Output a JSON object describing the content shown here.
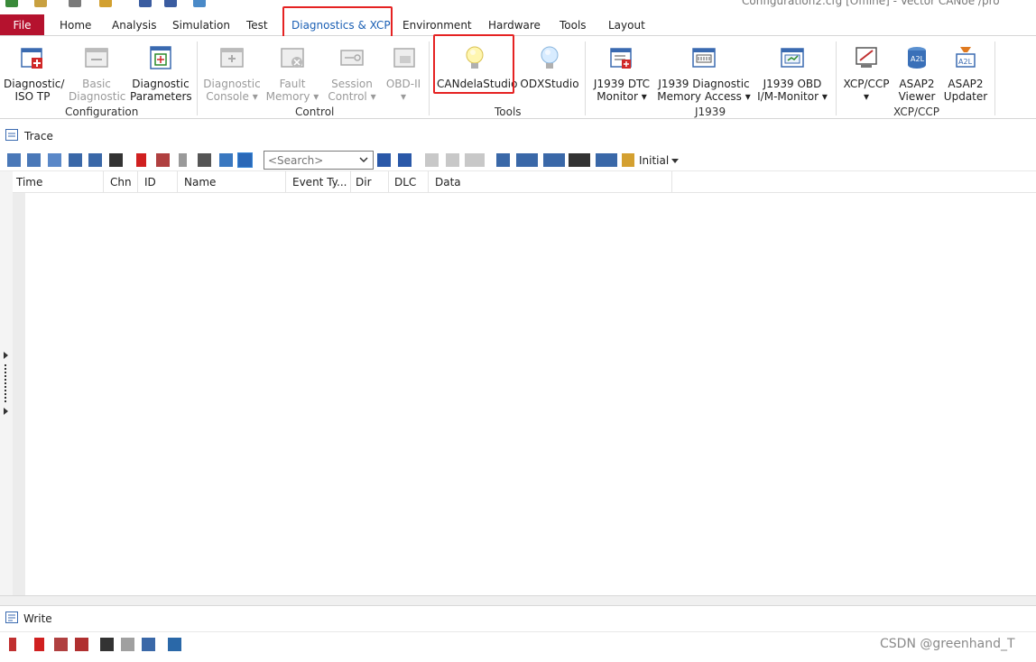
{
  "window": {
    "title": "Configuration2.cfg [Offline] - Vector CANoe /pro"
  },
  "ribbon_tabs": [
    "File",
    "Home",
    "Analysis",
    "Simulation",
    "Test",
    "Diagnostics & XCP",
    "Environment",
    "Hardware",
    "Tools",
    "Layout"
  ],
  "ribbon": {
    "buttons": {
      "diag_iso_tp": [
        "Diagnostic/",
        "ISO TP"
      ],
      "basic_diag": [
        "Basic",
        "Diagnostic"
      ],
      "diag_params": [
        "Diagnostic",
        "Parameters"
      ],
      "diag_console": [
        "Diagnostic",
        "Console ▾"
      ],
      "fault_memory": [
        "Fault",
        "Memory ▾"
      ],
      "session_control": [
        "Session",
        "Control ▾"
      ],
      "obd": [
        "OBD-II",
        "▾"
      ],
      "candelastudio": "CANdelaStudio",
      "odxstudio": "ODXStudio",
      "j1939_dtc": [
        "J1939 DTC",
        "Monitor ▾"
      ],
      "j1939_mem": [
        "J1939 Diagnostic",
        "Memory Access ▾"
      ],
      "j1939_obd": [
        "J1939 OBD",
        "I/M-Monitor ▾"
      ],
      "xcp_ccp": [
        "XCP/CCP",
        "▾"
      ],
      "asap2_viewer": [
        "ASAP2",
        "Viewer"
      ],
      "asap2_updater": [
        "ASAP2",
        "Updater"
      ]
    },
    "groups": {
      "configuration": "Configuration",
      "control": "Control",
      "tools": "Tools",
      "j1939": "J1939",
      "xcp_ccp": "XCP/CCP"
    }
  },
  "trace": {
    "title": "Trace",
    "search_placeholder": "<Search>",
    "initial_label": "Initial",
    "columns": [
      "Time",
      "Chn",
      "ID",
      "Name",
      "Event Ty...",
      "Dir",
      "DLC",
      "Data"
    ]
  },
  "write": {
    "title": "Write"
  },
  "watermark": "CSDN @greenhand_T",
  "colors": {
    "file_tab": "#b5122e",
    "highlight": "#e52222"
  }
}
